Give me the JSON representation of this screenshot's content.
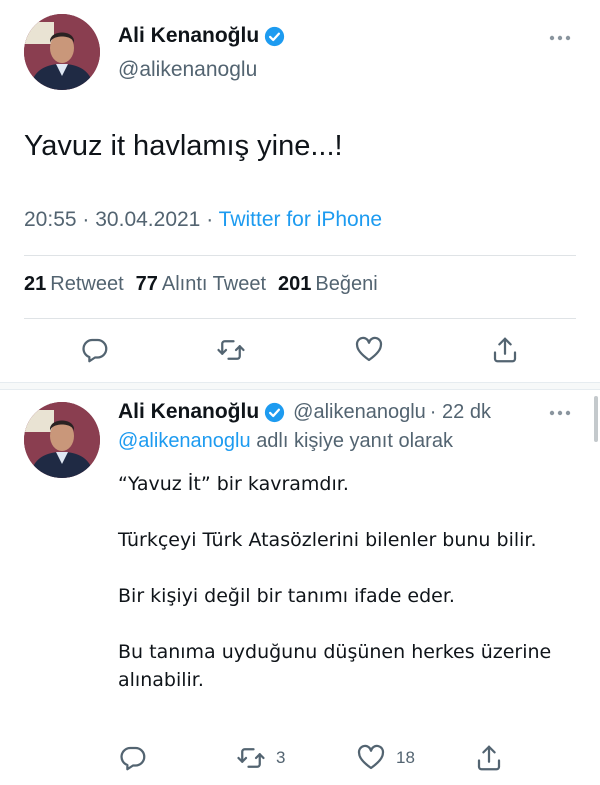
{
  "main_tweet": {
    "display_name": "Ali Kenanoğlu",
    "handle": "@alikenanoglu",
    "text": "Yavuz it havlamış yine...!",
    "time": "20:55",
    "date": "30.04.2021",
    "meta_sep": "·",
    "source": "Twitter for iPhone",
    "stats": {
      "retweets_count": "21",
      "retweets_label": "Retweet",
      "quotes_count": "77",
      "quotes_label": "Alıntı Tweet",
      "likes_count": "201",
      "likes_label": "Beğeni"
    }
  },
  "reply_tweet": {
    "display_name": "Ali Kenanoğlu",
    "handle": "@alikenanoglu",
    "time_ago": "· 22 dk",
    "replying_mention": "@alikenanoglu",
    "replying_suffix": "adlı kişiye yanıt olarak",
    "paragraphs": [
      "“Yavuz İt” bir kavramdır.",
      "Türkçeyi Türk Atasözlerini bilenler bunu bilir.",
      "Bir kişiyi değil bir tanımı ifade eder.",
      "Bu tanıma uyduğunu düşünen herkes üzerine alınabilir."
    ],
    "retweet_count": "3",
    "like_count": "18"
  },
  "icons": {
    "verified": "verified-badge-icon",
    "more": "more-options-icon",
    "reply": "reply-icon",
    "retweet": "retweet-icon",
    "like": "heart-icon",
    "share": "share-icon"
  },
  "colors": {
    "accent": "#1d9bf0",
    "text_primary": "#0f1419",
    "text_secondary": "#536471",
    "divider": "#dfe3e6"
  }
}
